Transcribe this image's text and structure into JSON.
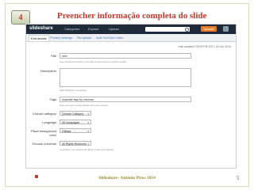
{
  "slide": {
    "step": "4",
    "title": "Preencher informação completa  do slide",
    "footer": "Slideshare- António Pires 2014",
    "page_number": "5"
  },
  "site": {
    "logo": "slideshare",
    "nav": [
      "Categories",
      "Explore",
      "Upload"
    ],
    "upload_button": "Upload",
    "saved_status": "Last updated: 00:00 PM UTC, 15 Jun 2014"
  },
  "tabs": [
    "Edit details",
    "Privacy settings",
    "Re-upload",
    "Add YouTube video"
  ],
  "form": {
    "title_label": "Title",
    "title_value": "xxxx",
    "title_help": "Use descriptive words in the title to help improve search results.",
    "description_label": "Description",
    "description_help": "300 characters remaining",
    "tags_label": "Tags",
    "tags_value": "separate tags by commas",
    "tags_help": "Use new tags to help people find your content",
    "category_label": "Choose category",
    "category_value": "Choose Category",
    "language_label": "Language",
    "language_value": "All Languages",
    "background_label": "Place background color",
    "background_value": "Ottawa",
    "license_label": "Choose a license",
    "license_value": "All Rights Reserved",
    "license_help": "Copyright: you reserve all rights to files you upload"
  },
  "colors": {
    "title_red": "#c0392b",
    "footer_gold": "#9a8a2a",
    "topbar": "#1f2b3a",
    "upload_orange": "#e47c2a"
  }
}
